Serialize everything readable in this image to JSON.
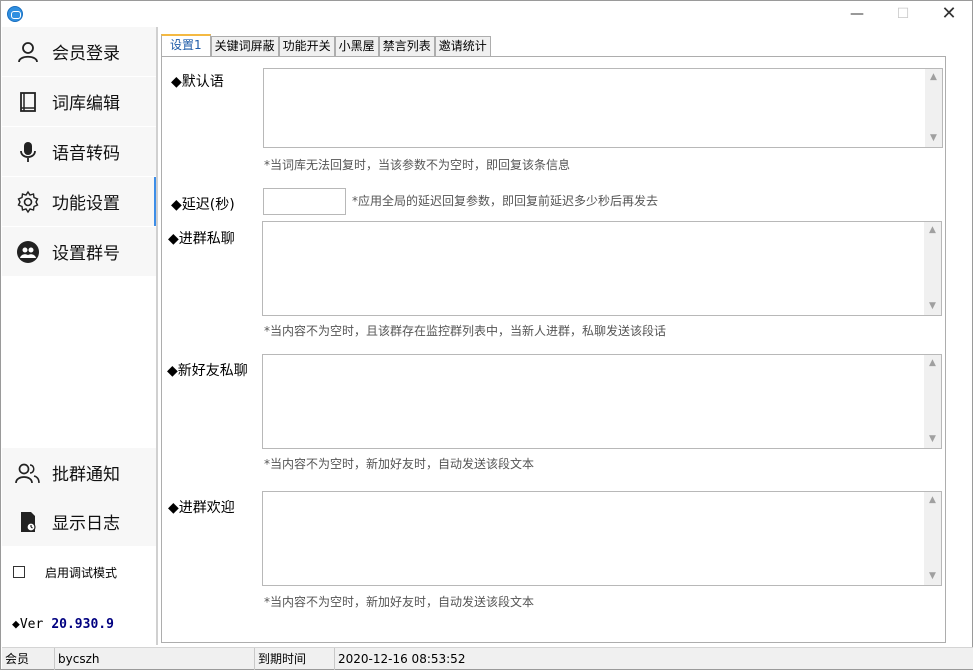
{
  "window": {
    "min_glyph": "—",
    "max_glyph": "☐",
    "close_glyph": "✕"
  },
  "sidebar": {
    "items": [
      {
        "label": "会员登录",
        "icon": "user-icon"
      },
      {
        "label": "词库编辑",
        "icon": "book-icon"
      },
      {
        "label": "语音转码",
        "icon": "microphone-icon"
      },
      {
        "label": "功能设置",
        "icon": "gear-icon"
      },
      {
        "label": "设置群号",
        "icon": "group-icon"
      }
    ],
    "bottom_items": [
      {
        "label": "批群通知",
        "icon": "users-icon"
      },
      {
        "label": "显示日志",
        "icon": "log-file-icon"
      }
    ],
    "debug_label": "启用调试模式",
    "version_prefix": "◆Ver",
    "version": "20.930.9",
    "accent_color": "#3d8ee8"
  },
  "tabs": [
    "设置1",
    "关键词屏蔽",
    "功能开关",
    "小黑屋",
    "禁言列表",
    "邀请统计"
  ],
  "settings": {
    "default_reply": {
      "label": "◆默认语",
      "value": "",
      "hint": "*当词库无法回复时，当该参数不为空时，即回复该条信息"
    },
    "delay": {
      "label": "◆延迟(秒)",
      "value": "",
      "hint": "*应用全局的延迟回复参数，即回复前延迟多少秒后再发去"
    },
    "join_private": {
      "label": "◆进群私聊",
      "value": "",
      "hint": "*当内容不为空时，且该群存在监控群列表中，当新人进群，私聊发送该段话"
    },
    "new_friend_private": {
      "label": "◆新好友私聊",
      "value": "",
      "hint": "*当内容不为空时，新加好友时，自动发送该段文本"
    },
    "join_welcome": {
      "label": "◆进群欢迎",
      "value": "",
      "hint": "*当内容不为空时，新加好友时，自动发送该段文本"
    }
  },
  "statusbar": {
    "member_label": "会员",
    "member_value": "bycszh",
    "expire_label": "到期时间",
    "expire_value": "2020-12-16 08:53:52"
  }
}
